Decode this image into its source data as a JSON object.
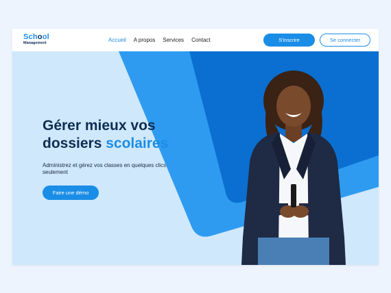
{
  "brand": {
    "name_part1": "Sch",
    "name_dot": "o",
    "name_part2": "ol",
    "subtitle": "Management"
  },
  "nav": {
    "items": [
      {
        "label": "Accueil",
        "active": true
      },
      {
        "label": "A propos",
        "active": false
      },
      {
        "label": "Services",
        "active": false
      },
      {
        "label": "Contact",
        "active": false
      }
    ],
    "signup_label": "S'inscrire",
    "login_label": "Se connecter"
  },
  "hero": {
    "headline_line1": "Gérer mieux vos",
    "headline_line2_plain": "dossiers ",
    "headline_line2_accent": "scolaires",
    "subtext": "Administrez et gérez vos classes en quelques clics seulement",
    "cta_label": "Faire une démo"
  },
  "colors": {
    "accent": "#1a8de6",
    "dark_text": "#0f2d52",
    "hero_bg": "#cfe8fb",
    "shape_mid": "#2e9bf0",
    "shape_dark": "#0a6fd0",
    "page_bg": "#eef4fd"
  },
  "icons": {
    "person_image": "woman-portrait-photo"
  }
}
